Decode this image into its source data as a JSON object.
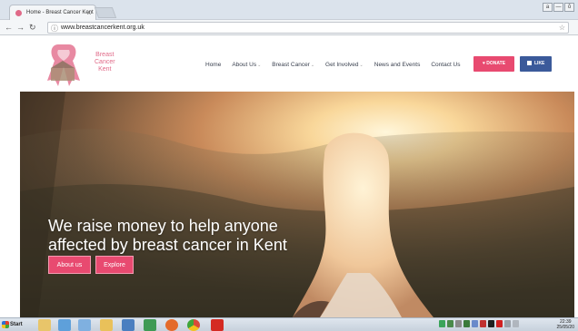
{
  "browser": {
    "tab_title": "Home - Breast Cancer Kent",
    "tab_close": "x",
    "url": "www.breastcancerkent.org.uk",
    "window_controls": [
      "a",
      "—",
      "ŏ"
    ]
  },
  "site": {
    "logo_lines": [
      "Breast",
      "Cancer",
      "Kent"
    ],
    "menu": [
      {
        "label": "Home",
        "dropdown": false
      },
      {
        "label": "About Us",
        "dropdown": true
      },
      {
        "label": "Breast Cancer",
        "dropdown": true
      },
      {
        "label": "Get Involved",
        "dropdown": true
      },
      {
        "label": "News and Events",
        "dropdown": false
      },
      {
        "label": "Contact Us",
        "dropdown": false
      }
    ],
    "donate_label": "DONATE",
    "like_label": "LIKE",
    "hero": {
      "headline_line1": "We raise money to help anyone",
      "headline_line2": "affected by breast cancer in Kent",
      "about_label": "About us",
      "explore_label": "Explore"
    },
    "brand_color": "#e84a70"
  },
  "taskbar": {
    "start_label": "Start",
    "clock_time": "22:39",
    "clock_date": "25/05/20"
  }
}
